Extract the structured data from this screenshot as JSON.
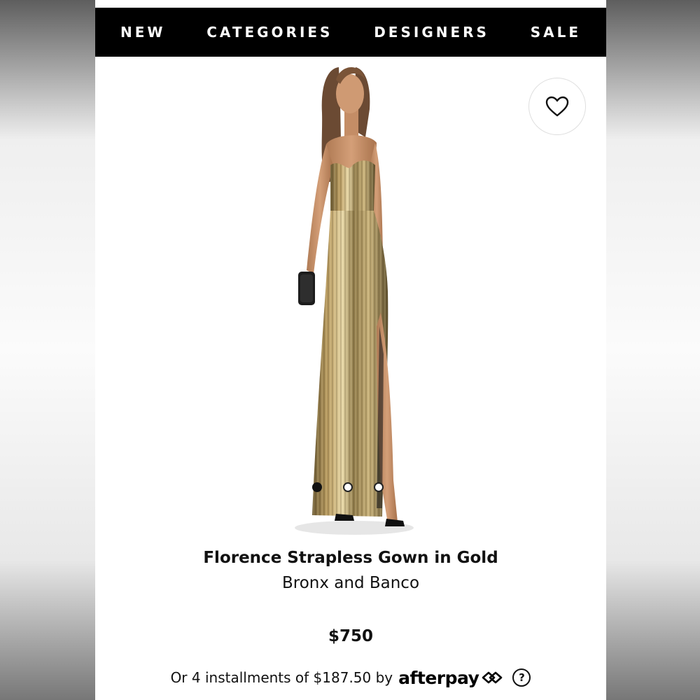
{
  "nav": {
    "items": [
      {
        "label": "NEW"
      },
      {
        "label": "CATEGORIES"
      },
      {
        "label": "DESIGNERS"
      },
      {
        "label": "SALE"
      }
    ]
  },
  "product": {
    "image_icon": "gold-strapless-gown-photo",
    "title": "Florence Strapless Gown in Gold",
    "designer": "Bronx and Banco",
    "price": "$750"
  },
  "carousel": {
    "total_images": 3,
    "active_index": 0
  },
  "favorite": {
    "icon": "heart-icon"
  },
  "afterpay": {
    "text": "Or 4 installments of $187.50 by",
    "brand": "afterpay",
    "help_glyph": "?"
  },
  "colors": {
    "nav_background": "#000000",
    "nav_text": "#ffffff",
    "text": "#111111"
  }
}
